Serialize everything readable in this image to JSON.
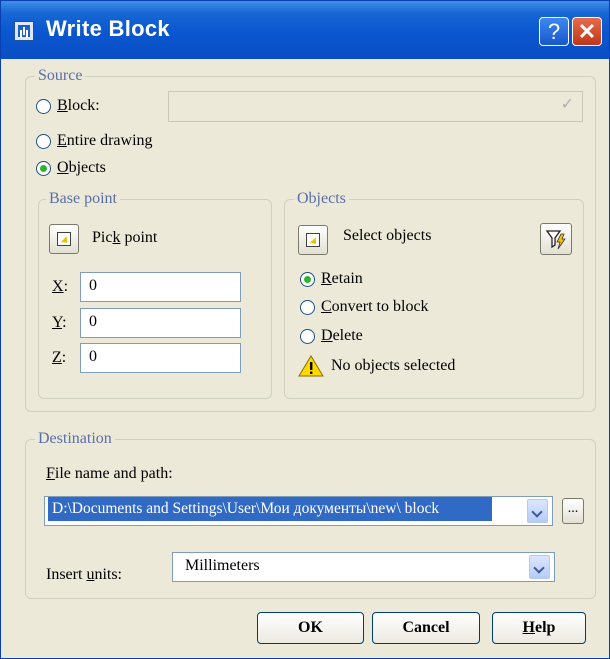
{
  "window": {
    "title": "Write Block",
    "help_button": "?",
    "close_button": "✕"
  },
  "source": {
    "legend": "Source",
    "block": {
      "label_pre": "",
      "label_u": "B",
      "label_post": "lock:",
      "value": ""
    },
    "entire": {
      "label_pre": "",
      "label_u": "E",
      "label_post": "ntire drawing"
    },
    "objects": {
      "label_pre": "",
      "label_u": "O",
      "label_post": "bjects"
    },
    "selected": "objects"
  },
  "base_point": {
    "legend": "Base point",
    "pick": {
      "label_pre": "Pic",
      "label_u": "k",
      "label_post": " point"
    },
    "x": {
      "label_u": "X",
      "label_post": ":",
      "value": "0"
    },
    "y": {
      "label_u": "Y",
      "label_post": ":",
      "value": "0"
    },
    "z": {
      "label_u": "Z",
      "label_post": ":",
      "value": "0"
    }
  },
  "objects_group": {
    "legend": "Objects",
    "select_label": "Select objects",
    "retain": {
      "label_u": "R",
      "label_post": "etain"
    },
    "convert": {
      "label_u": "C",
      "label_post": "onvert to block"
    },
    "delete": {
      "label_u": "D",
      "label_post": "elete"
    },
    "selected": "retain",
    "status": "No objects selected"
  },
  "destination": {
    "legend": "Destination",
    "file_label": {
      "label_u": "F",
      "label_post": "ile name and path:"
    },
    "file_value": "D:\\Documents and Settings\\User\\Мои документы\\new\\ block",
    "browse": "...",
    "units_label": {
      "label_pre": "Insert ",
      "label_u": "u",
      "label_post": "nits:"
    },
    "units_value": "Millimeters"
  },
  "buttons": {
    "ok": "OK",
    "cancel": "Cancel",
    "help_pre": "",
    "help_u": "H",
    "help_post": "elp"
  },
  "colors": {
    "title_bar": "#0a56cf",
    "face": "#ece9d8",
    "legend_text": "#5b6fa8",
    "radio_dot": "#2fb32f",
    "selection": "#316ac5"
  }
}
